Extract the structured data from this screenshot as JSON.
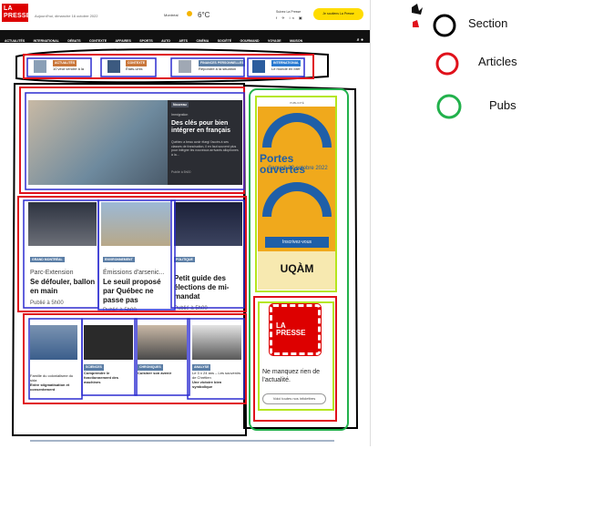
{
  "header": {
    "logo": "LA PRESSE",
    "date": "Aujourd'hui, dimanche 16 octobre 2022",
    "city": "Montréal",
    "temperature": "6°C",
    "follow": "Suivez La Presse",
    "social_icons": "f ✈ in ▣",
    "subscribe": "Je soutiens La Presse"
  },
  "nav": {
    "items": [
      "ACTUALITÉS",
      "INTERNATIONAL",
      "DÉBATS",
      "CONTEXTE",
      "AFFAIRES",
      "SPORTS",
      "AUTO",
      "ARTS",
      "CINÉMA",
      "SOCIÉTÉ",
      "GOURMAND",
      "VOYAGE",
      "MAISON"
    ]
  },
  "topstrip": {
    "items": [
      {
        "tag": "ACTUALITÉS",
        "text": "10 veut vendre à la"
      },
      {
        "tag": "CONTEXTE",
        "text": "États-Unis"
      },
      {
        "tag": "FINANCES PERSONNELLES",
        "text": "Répondre à la situation"
      },
      {
        "tag": "INTERNATIONAL",
        "text": "Le monde en bref"
      }
    ]
  },
  "feature": {
    "badge": "Nouveau",
    "tag": "Immigration",
    "title": "Des clés pour bien intégrer en français",
    "excerpt": "Québec a beau avoir élargi l'accès à ses classes de francisation, il en faut souvent plus pour intégrer les nouveaux arrivants allophones à la...",
    "time": "Publié à 5h00"
  },
  "cards": [
    {
      "tag": "GRAND MONTRÉAL",
      "place": "Parc-Extension",
      "title": "Se défouler, ballon en main",
      "time": "Publié à 5h00"
    },
    {
      "tag": "ENVIRONNEMENT",
      "place": "Émissions d'arsenic...",
      "title": "Le seuil proposé par Québec ne passe pas",
      "time": "Publié à 5h00"
    },
    {
      "tag": "POLITIQUE",
      "place": "",
      "title": "Petit guide des élections de mi-mandat",
      "time": "Publié à 5h00"
    }
  ],
  "small_cards": [
    {
      "tag": "",
      "text": "Famille du colonialisme du sida",
      "title": "Entre stigmatisation et consentement"
    },
    {
      "tag": "SCIENCES",
      "text": "Comprendre le fonctionnement des machines",
      "title": ""
    },
    {
      "tag": "CHRONIQUES",
      "text": "",
      "title": "Cuisiner son avenir"
    },
    {
      "tag": "ANALYSE",
      "text": "Le 3 x 24 ans – Les souvenirs de Chrétien",
      "title": "Une victoire bien symbolique"
    }
  ],
  "ad1": {
    "label": "PUBLICITÉ",
    "headline": "Portes ouvertes",
    "date": "Samedi 22 octobre 2022",
    "cta": "Inscrivez-vous",
    "brand": "UQÀM"
  },
  "ad2": {
    "logo": "LA PRESSE",
    "text": "Ne manquez rien de l'actualité.",
    "button": "Voici toutes nos infolettres"
  },
  "legend": {
    "section": "Section",
    "articles": "Articles",
    "pubs": "Pubs"
  },
  "colors": {
    "section": "#000000",
    "articles": "#e0111b",
    "pubs": "#22b14c",
    "inner_articles": "#2d2dd0",
    "inner_pubs": "#b5e61d"
  }
}
